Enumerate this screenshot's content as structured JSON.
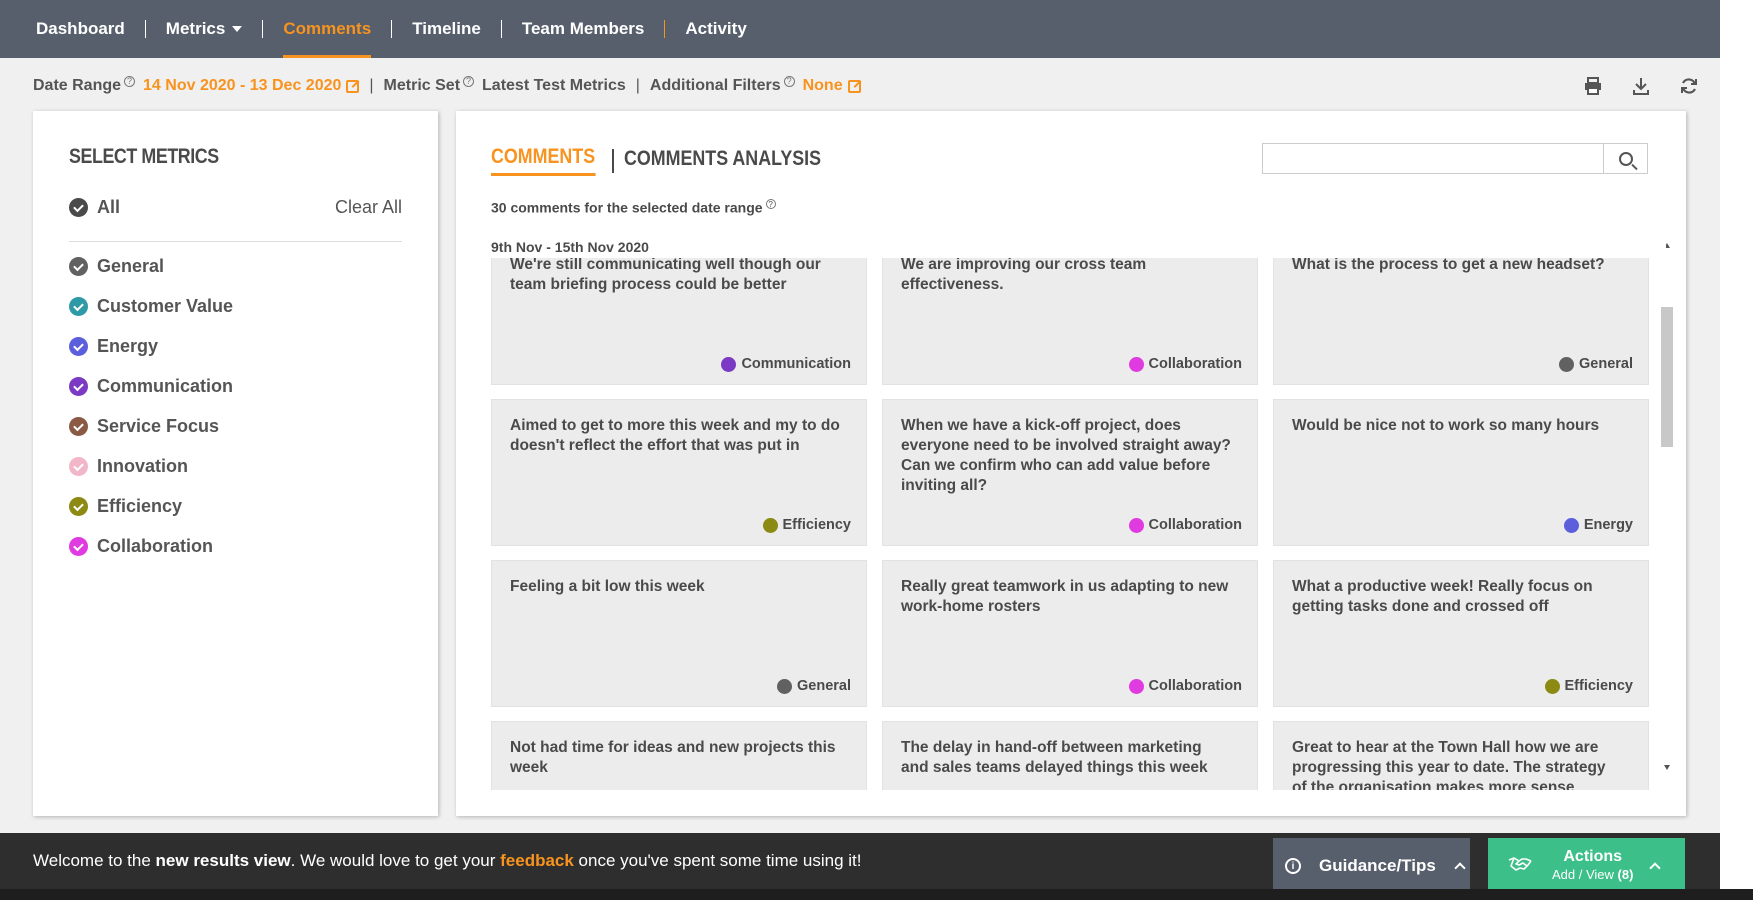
{
  "nav": {
    "items": [
      {
        "label": "Dashboard"
      },
      {
        "label": "Metrics"
      },
      {
        "label": "Comments"
      },
      {
        "label": "Timeline"
      },
      {
        "label": "Team Members"
      },
      {
        "label": "Activity"
      }
    ],
    "active": "Comments"
  },
  "filters": {
    "date_range_label": "Date Range",
    "date_range_value": "14 Nov 2020 - 13 Dec 2020",
    "metric_set_label": "Metric Set",
    "metric_set_value": "Latest Test Metrics",
    "additional_filters_label": "Additional Filters",
    "additional_filters_value": "None",
    "separator": "|"
  },
  "toolbar": {
    "print_icon": "print-icon",
    "download_icon": "download-icon",
    "refresh_icon": "refresh-icon"
  },
  "select_metrics": {
    "title": "Select Metrics",
    "all_label": "All",
    "clear_all": "Clear All",
    "items": [
      {
        "label": "General",
        "color": "#616161"
      },
      {
        "label": "Customer Value",
        "color": "#2e9aa6"
      },
      {
        "label": "Energy",
        "color": "#5b5fdc"
      },
      {
        "label": "Communication",
        "color": "#7b3ac4"
      },
      {
        "label": "Service Focus",
        "color": "#8a5a44"
      },
      {
        "label": "Innovation",
        "color": "#f2b6c9"
      },
      {
        "label": "Efficiency",
        "color": "#8c8a12"
      },
      {
        "label": "Collaboration",
        "color": "#e03be0"
      }
    ]
  },
  "comments": {
    "tab_comments": "Comments",
    "tab_analysis": "Comments Analysis",
    "tab_separator": "|",
    "search_placeholder": "",
    "count_text": "30 comments for the selected date range",
    "week_label": "9th Nov - 15th Nov 2020",
    "cards": [
      {
        "text": "We're still communicating well though our team briefing process could be better",
        "tag": "Communication",
        "color": "#7b3ac4"
      },
      {
        "text": "We are improving our cross team effectiveness.",
        "tag": "Collaboration",
        "color": "#e03be0"
      },
      {
        "text": "What is the process to get a new headset?",
        "tag": "General",
        "color": "#616161"
      },
      {
        "text": "Aimed to get to more this week and my to do doesn't reflect the effort that was put in",
        "tag": "Efficiency",
        "color": "#8c8a12"
      },
      {
        "text": "When we have a kick-off project, does everyone need to be involved straight away? Can we confirm who can add value before inviting all?",
        "tag": "Collaboration",
        "color": "#e03be0"
      },
      {
        "text": "Would be nice not to work so many hours",
        "tag": "Energy",
        "color": "#5b5fdc"
      },
      {
        "text": "Feeling a bit low this week",
        "tag": "General",
        "color": "#616161"
      },
      {
        "text": "Really great teamwork in us adapting to new work-home rosters",
        "tag": "Collaboration",
        "color": "#e03be0"
      },
      {
        "text": "What a productive week! Really focus on getting tasks done and crossed off",
        "tag": "Efficiency",
        "color": "#8c8a12"
      },
      {
        "text": "Not had time for ideas and new projects this week",
        "tag": "",
        "color": ""
      },
      {
        "text": "The delay in hand-off between marketing and sales teams delayed things this week",
        "tag": "",
        "color": ""
      },
      {
        "text": "Great to hear at the Town Hall how we are progressing this year to date. The strategy of the organisation makes more sense",
        "tag": "",
        "color": ""
      }
    ]
  },
  "bottom": {
    "welcome_pre": "Welcome to the ",
    "welcome_bold": "new results view",
    "welcome_mid": ". We would love to get your ",
    "welcome_link": "feedback",
    "welcome_post": " once you've spent some time using it!",
    "guidance_label": "Guidance/Tips",
    "actions_title": "Actions",
    "actions_sub_prefix": "Add / View ",
    "actions_count": "(8)"
  },
  "colors": {
    "accent": "#f7931e",
    "nav_bg": "#575f6c",
    "actions_green": "#3dbf8a",
    "bottom_bg": "#2e2e2e"
  }
}
